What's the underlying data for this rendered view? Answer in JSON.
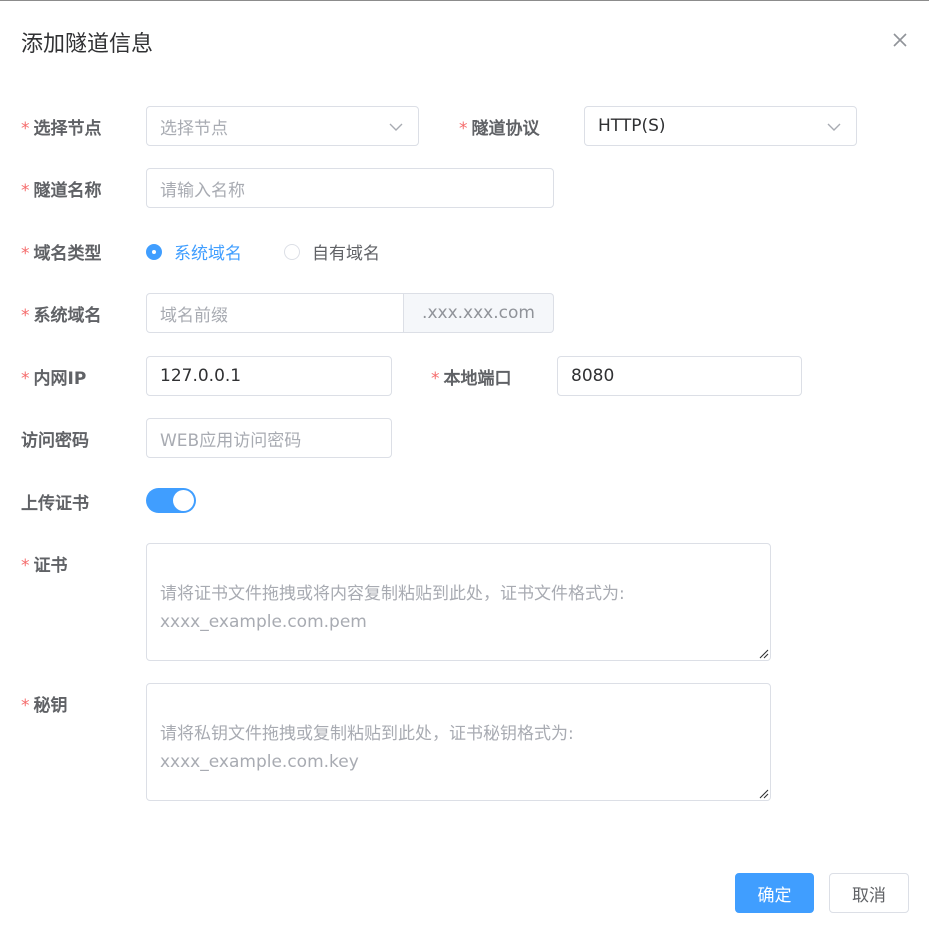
{
  "dialog": {
    "title": "添加隧道信息"
  },
  "fields": {
    "node": {
      "required": true,
      "label": "选择节点",
      "placeholder": "选择节点"
    },
    "protocol": {
      "required": true,
      "label": "隧道协议",
      "value": "HTTP(S)"
    },
    "tunnel_name": {
      "required": true,
      "label": "隧道名称",
      "placeholder": "请输入名称"
    },
    "domain_type": {
      "required": true,
      "label": "域名类型",
      "options": [
        "系统域名",
        "自有域名"
      ],
      "selected": "系统域名"
    },
    "system_domain": {
      "required": true,
      "label": "系统域名",
      "placeholder": "域名前缀",
      "suffix": ".xxx.xxx.com"
    },
    "intranet_ip": {
      "required": true,
      "label": "内网IP",
      "value": "127.0.0.1"
    },
    "local_port": {
      "required": true,
      "label": "本地端口",
      "value": "8080"
    },
    "access_password": {
      "required": false,
      "label": "访问密码",
      "placeholder": "WEB应用访问密码"
    },
    "upload_cert": {
      "required": false,
      "label": "上传证书",
      "enabled": true
    },
    "certificate": {
      "required": true,
      "label": "证书",
      "placeholder": "请将证书文件拖拽或将内容复制粘贴到此处，证书文件格式为:\nxxxx_example.com.pem"
    },
    "private_key": {
      "required": true,
      "label": "秘钥",
      "placeholder": "请将私钥文件拖拽或复制粘贴到此处，证书秘钥格式为:\nxxxx_example.com.key"
    }
  },
  "required_marker": "*",
  "buttons": {
    "confirm": "确定",
    "cancel": "取消"
  },
  "icons": {
    "close": "close-icon",
    "dropdown": "chevron-down-icon"
  },
  "colors": {
    "primary": "#409eff",
    "required": "#f56c6c",
    "border": "#dcdfe6"
  }
}
